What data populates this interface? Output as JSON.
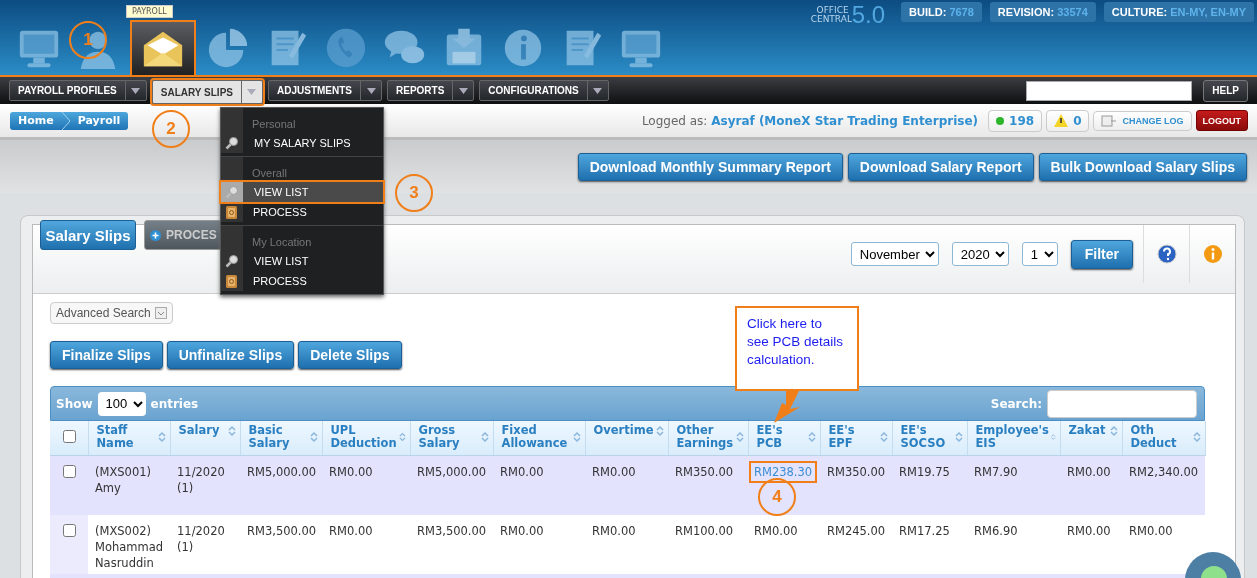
{
  "header": {
    "tooltip": "PAYROLL",
    "product_name": "OFFICE CENTRAL",
    "version": "5.0",
    "modules": [
      {
        "selected": false,
        "highlighted": false
      },
      {
        "selected": false,
        "highlighted": false
      },
      {
        "selected": true,
        "highlighted": true
      },
      {
        "selected": false,
        "highlighted": false
      },
      {
        "selected": false,
        "highlighted": false
      },
      {
        "selected": false,
        "highlighted": false
      },
      {
        "selected": false,
        "highlighted": false
      },
      {
        "selected": false,
        "highlighted": false
      },
      {
        "selected": false,
        "highlighted": false
      },
      {
        "selected": false,
        "highlighted": false
      },
      {
        "selected": false,
        "highlighted": false
      }
    ],
    "build_info": [
      {
        "label": "BUILD:",
        "value": "7678"
      },
      {
        "label": "REVISION:",
        "value": "33574"
      },
      {
        "label": "CULTURE:",
        "value": "EN-MY, EN-MY"
      }
    ]
  },
  "nav": {
    "menus": [
      {
        "label": "PAYROLL PROFILES",
        "selected": false,
        "highlighted": false
      },
      {
        "label": "SALARY SLIPS",
        "selected": true,
        "highlighted": true
      },
      {
        "label": "ADJUSTMENTS",
        "selected": false,
        "highlighted": false
      },
      {
        "label": "REPORTS",
        "selected": false,
        "highlighted": false
      },
      {
        "label": "CONFIGURATIONS",
        "selected": false,
        "highlighted": false
      }
    ],
    "help": "HELP"
  },
  "breadcrumb": [
    "Home",
    "Payroll"
  ],
  "user": {
    "prefix": "Logged as:",
    "name": "Asyraf (MoneX Star Trading Enterprise)",
    "online_count": "198",
    "alert_count": "0",
    "change_log": "CHANGE LOG",
    "logout": "LOGOUT"
  },
  "actions": [
    "Download Monthly Summary Report",
    "Download Salary Report",
    "Bulk Download Salary Slips"
  ],
  "panel": {
    "tabs": [
      {
        "label": "Salary Slips",
        "selected": true
      },
      {
        "label": "PROCES",
        "selected": false
      }
    ],
    "filters": {
      "month": "November",
      "year": "2020",
      "run": "1",
      "button": "Filter"
    },
    "advanced_search": "Advanced Search",
    "bulk_buttons": [
      "Finalize Slips",
      "Unfinalize Slips",
      "Delete Slips"
    ],
    "table": {
      "show_label": "Show",
      "entries_value": "100",
      "entries_label": "entries",
      "search_label": "Search:",
      "select_all": {
        "checked": false
      },
      "columns": [
        {
          "label": "Staff Name",
          "kind": "text"
        },
        {
          "label": "Salary",
          "kind": "text"
        },
        {
          "label": "Basic Salary",
          "kind": "text"
        },
        {
          "label": "UPL Deduction",
          "kind": "text"
        },
        {
          "label": "Gross Salary",
          "kind": "text"
        },
        {
          "label": "Fixed Allowance",
          "kind": "text"
        },
        {
          "label": "Overtime",
          "kind": "text"
        },
        {
          "label": "Other Earnings",
          "kind": "text"
        },
        {
          "label": "EE's PCB",
          "kind": "pcb"
        },
        {
          "label": "EE's EPF",
          "kind": "text"
        },
        {
          "label": "EE's SOCSO",
          "kind": "text"
        },
        {
          "label": "Employee's EIS",
          "kind": "text"
        },
        {
          "label": "Zakat",
          "kind": "text"
        },
        {
          "label": "Oth Deduct",
          "kind": "text"
        }
      ],
      "rows": [
        {
          "checked": false,
          "pcb_link": true,
          "pcb_highlighted": true,
          "cells": [
            "(MXS001) Amy",
            "11/2020 (1)",
            "RM5,000.00",
            "RM0.00",
            "RM5,000.00",
            "RM0.00",
            "RM0.00",
            "RM350.00",
            "RM238.30",
            "RM350.00",
            "RM19.75",
            "RM7.90",
            "RM0.00",
            "RM2,340.00"
          ]
        },
        {
          "checked": false,
          "pcb_link": false,
          "pcb_highlighted": false,
          "cells": [
            "(MXS002) Mohammad Nasruddin",
            "11/2020 (1)",
            "RM3,500.00",
            "RM0.00",
            "RM3,500.00",
            "RM0.00",
            "RM0.00",
            "RM100.00",
            "RM0.00",
            "RM245.00",
            "RM17.25",
            "RM6.90",
            "RM0.00",
            "RM0.00"
          ]
        }
      ]
    }
  },
  "dropdown": {
    "sections": [
      {
        "heading": "Personal",
        "items": [
          {
            "label": "MY SALARY SLIPS",
            "kind": "view",
            "selected": false,
            "highlighted": false
          }
        ]
      },
      {
        "heading": "Overall",
        "items": [
          {
            "label": "VIEW LIST",
            "kind": "view",
            "selected": true,
            "highlighted": true
          },
          {
            "label": "PROCESS",
            "kind": "process",
            "selected": false,
            "highlighted": false
          }
        ]
      },
      {
        "heading": "My Location",
        "items": [
          {
            "label": "VIEW LIST",
            "kind": "view",
            "selected": false,
            "highlighted": false
          },
          {
            "label": "PROCESS",
            "kind": "process",
            "selected": false,
            "highlighted": false
          }
        ]
      }
    ]
  },
  "annotations": {
    "steps": [
      "1",
      "2",
      "3",
      "4"
    ],
    "callout": "Click here to see PCB details calculation."
  }
}
